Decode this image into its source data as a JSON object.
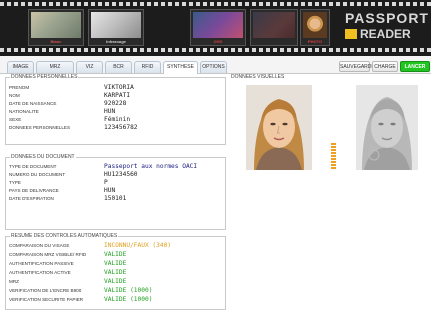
{
  "header": {
    "frames": [
      {
        "caption": "Blanc"
      },
      {
        "caption": "Infrarouge"
      },
      {
        "caption": "OVD"
      },
      {
        "caption": ""
      },
      {
        "caption": "PHOTO"
      }
    ],
    "logo_line1": "PASSPORT",
    "logo_line2": "READER"
  },
  "tabs": [
    {
      "label": "IMAGE"
    },
    {
      "label": "MRZ"
    },
    {
      "label": "VIZ"
    },
    {
      "label": "BCR"
    },
    {
      "label": "RFID"
    },
    {
      "label": "SYNTHESE"
    },
    {
      "label": "OPTIONS"
    }
  ],
  "active_tab": "SYNTHESE",
  "actions": {
    "save": "SAUVEGARDE",
    "load": "CHARGE",
    "launch": "LANCER"
  },
  "personal": {
    "title": "DONNEES PERSONNELLES",
    "rows": [
      {
        "label": "PRENOM",
        "value": "VIKTORIA"
      },
      {
        "label": "NOM",
        "value": "KARPATI"
      },
      {
        "label": "DATE DE NAISSANCE",
        "value": "920228"
      },
      {
        "label": "NATIONALITE",
        "value": "HUN"
      },
      {
        "label": "SEXE",
        "value": "Féminin"
      },
      {
        "label": "DONNEES PERSONNELLES",
        "value": "123456782"
      }
    ]
  },
  "document": {
    "title": "DONNEES DU DOCUMENT",
    "rows": [
      {
        "label": "TYPE DE DOCUMENT",
        "value": "Passeport aux normes OACI"
      },
      {
        "label": "NUMERO DU DOCUMENT",
        "value": "HU1234560"
      },
      {
        "label": "TYPE",
        "value": "P"
      },
      {
        "label": "PAYS DE DELIVRANCE",
        "value": "HUN"
      },
      {
        "label": "DATE D'EXPIRATION",
        "value": "150101"
      }
    ]
  },
  "checks": {
    "title": "RESUME DES CONTROLES AUTOMATIQUES",
    "rows": [
      {
        "label": "COMPARAISON DU VISAGE",
        "value": "INCONNU/FAUX (340)"
      },
      {
        "label": "COMPARAISON MRZ VISIBLE/ RFID",
        "value": "VALIDE"
      },
      {
        "label": "AUTHENTIFICATION PASSIVE",
        "value": "VALIDE"
      },
      {
        "label": "AUTHENTIFICATION ACTIVE",
        "value": "VALIDE"
      },
      {
        "label": "MRZ",
        "value": "VALIDE"
      },
      {
        "label": "VERIFICATION DE L'ENCRE B900",
        "value": "VALIDE (1000)"
      },
      {
        "label": "VERIFICATION SECURITE PAPIER",
        "value": "VALIDE (1000)"
      }
    ]
  },
  "visual": {
    "title": "DONNEES VISUELLES"
  },
  "colors": {
    "warn": "#e0a020",
    "ok": "#22a022",
    "launch": "#22c422"
  }
}
